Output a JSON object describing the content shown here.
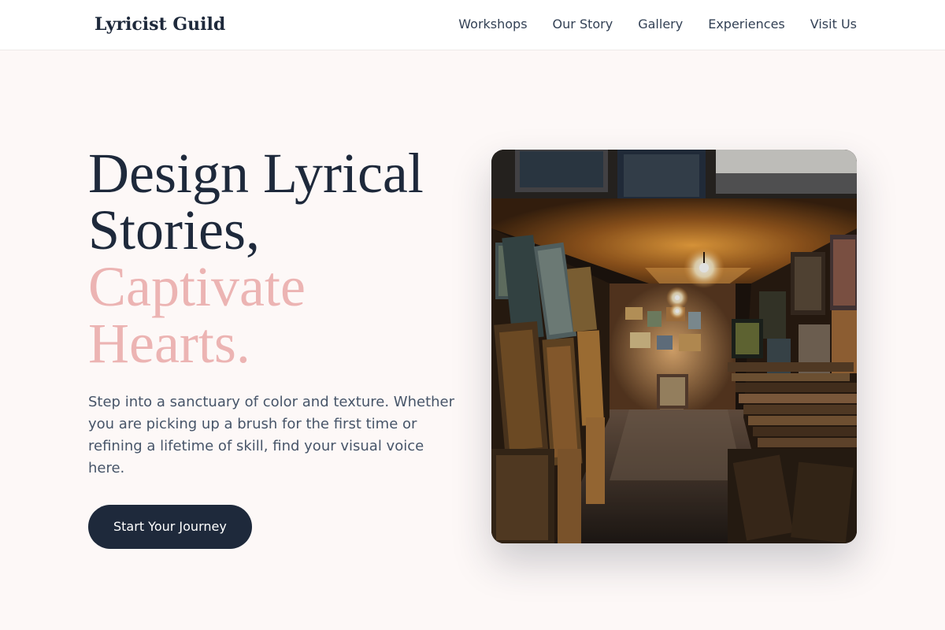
{
  "header": {
    "brand": "Lyricist Guild",
    "nav": [
      {
        "label": "Workshops"
      },
      {
        "label": "Our Story"
      },
      {
        "label": "Gallery"
      },
      {
        "label": "Experiences"
      },
      {
        "label": "Visit Us"
      }
    ]
  },
  "hero": {
    "headline_line1": "Design Lyrical",
    "headline_line2": "Stories,",
    "headline_accent_line1": "Captivate",
    "headline_accent_line2": "Hearts.",
    "description": "Step into a sanctuary of color and texture. Whether you are picking up a brush for the first time or refining a lifetime of skill, find your visual voice here.",
    "cta_label": "Start Your Journey",
    "image_subject": "art-gallery-corridor"
  },
  "colors": {
    "background": "#fdf8f7",
    "dark": "#1e293b",
    "accent": "#ecb4b3",
    "body_text": "#475569"
  }
}
